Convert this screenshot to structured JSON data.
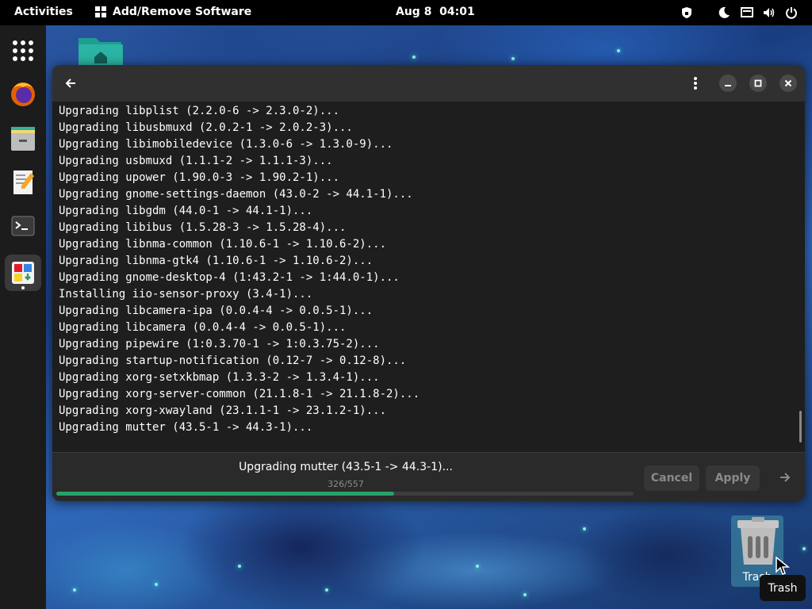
{
  "topbar": {
    "activities": "Activities",
    "app_name": "Add/Remove Software",
    "clock": "Aug 8  04:01",
    "tray_icons": [
      "shield-icon",
      "night-light-icon",
      "display-icon",
      "volume-icon",
      "power-icon"
    ]
  },
  "dock": {
    "items": [
      "app-grid-icon",
      "firefox-icon",
      "files-icon",
      "text-editor-icon",
      "terminal-icon",
      "software-icon"
    ],
    "active": "software-icon"
  },
  "desktop": {
    "home_folder_icon": "home-folder-icon",
    "trash_label": "Trash"
  },
  "window": {
    "log_lines": [
      "Upgrading libplist (2.2.0-6 -> 2.3.0-2)...",
      "Upgrading libusbmuxd (2.0.2-1 -> 2.0.2-3)...",
      "Upgrading libimobiledevice (1.3.0-6 -> 1.3.0-9)...",
      "Upgrading usbmuxd (1.1.1-2 -> 1.1.1-3)...",
      "Upgrading upower (1.90.0-3 -> 1.90.2-1)...",
      "Upgrading gnome-settings-daemon (43.0-2 -> 44.1-1)...",
      "Upgrading libgdm (44.0-1 -> 44.1-1)...",
      "Upgrading libibus (1.5.28-3 -> 1.5.28-4)...",
      "Upgrading libnma-common (1.10.6-1 -> 1.10.6-2)...",
      "Upgrading libnma-gtk4 (1.10.6-1 -> 1.10.6-2)...",
      "Upgrading gnome-desktop-4 (1:43.2-1 -> 1:44.0-1)...",
      "Installing iio-sensor-proxy (3.4-1)...",
      "Upgrading libcamera-ipa (0.0.4-4 -> 0.0.5-1)...",
      "Upgrading libcamera (0.0.4-4 -> 0.0.5-1)...",
      "Upgrading pipewire (1:0.3.70-1 -> 1:0.3.75-2)...",
      "Upgrading startup-notification (0.12-7 -> 0.12-8)...",
      "Upgrading xorg-setxkbmap (1.3.3-2 -> 1.3.4-1)...",
      "Upgrading xorg-server-common (21.1.8-1 -> 21.1.8-2)...",
      "Upgrading xorg-xwayland (23.1.1-1 -> 23.1.2-1)...",
      "Upgrading mutter (43.5-1 -> 44.3-1)..."
    ],
    "status_text": "Upgrading mutter (43.5-1 -> 44.3-1)...",
    "progress_text": "326/557",
    "progress_fraction": 0.585,
    "cancel_label": "Cancel",
    "apply_label": "Apply",
    "progress_color": "#26a269"
  },
  "tooltip": "Trash"
}
